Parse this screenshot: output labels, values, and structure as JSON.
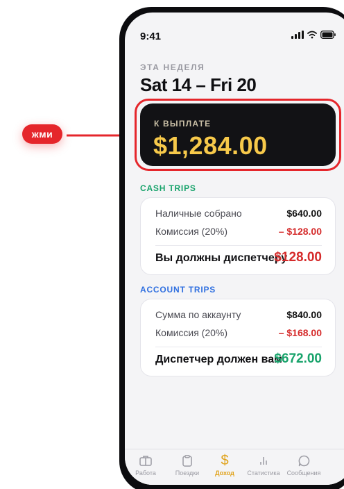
{
  "annotation": {
    "label": "жми"
  },
  "status_bar": {
    "time": "9:41"
  },
  "header": {
    "week_label": "ЭТА НЕДЕЛЯ",
    "week_range": "Sat 14 – Fri 20"
  },
  "payout": {
    "label": "К ВЫПЛАТЕ",
    "amount": "$1,284.00",
    "accent_color": "#f7c94a"
  },
  "cash_trips": {
    "title": "CASH TRIPS",
    "rows": [
      {
        "label": "Наличные собрано",
        "value": "$640.00"
      },
      {
        "label": "Комиссия (20%)",
        "value": "– $128.00"
      }
    ],
    "total_label": "Вы должны диспетчеру",
    "total_value": "$128.00"
  },
  "account_trips": {
    "title": "ACCOUNT TRIPS",
    "rows": [
      {
        "label": "Сумма по аккаунту",
        "value": "$840.00"
      },
      {
        "label": "Комиссия (20%)",
        "value": "– $168.00"
      }
    ],
    "total_label": "Диспетчер должен вам",
    "total_value": "$672.00"
  },
  "tab_bar": {
    "tabs": [
      {
        "label": "Работа",
        "icon": "briefcase-icon"
      },
      {
        "label": "Поездки",
        "icon": "clipboard-icon"
      },
      {
        "label": "Доход",
        "icon": "dollar-icon",
        "active": true
      },
      {
        "label": "Статистика",
        "icon": "bar-chart-icon"
      },
      {
        "label": "Сообщения",
        "icon": "chat-bubble-icon"
      }
    ]
  },
  "colors": {
    "highlight": "#e5262b",
    "cash": "#18a36b",
    "account": "#2f6fe0",
    "negative": "#d52b2b",
    "active_tab": "#e0a21a"
  }
}
